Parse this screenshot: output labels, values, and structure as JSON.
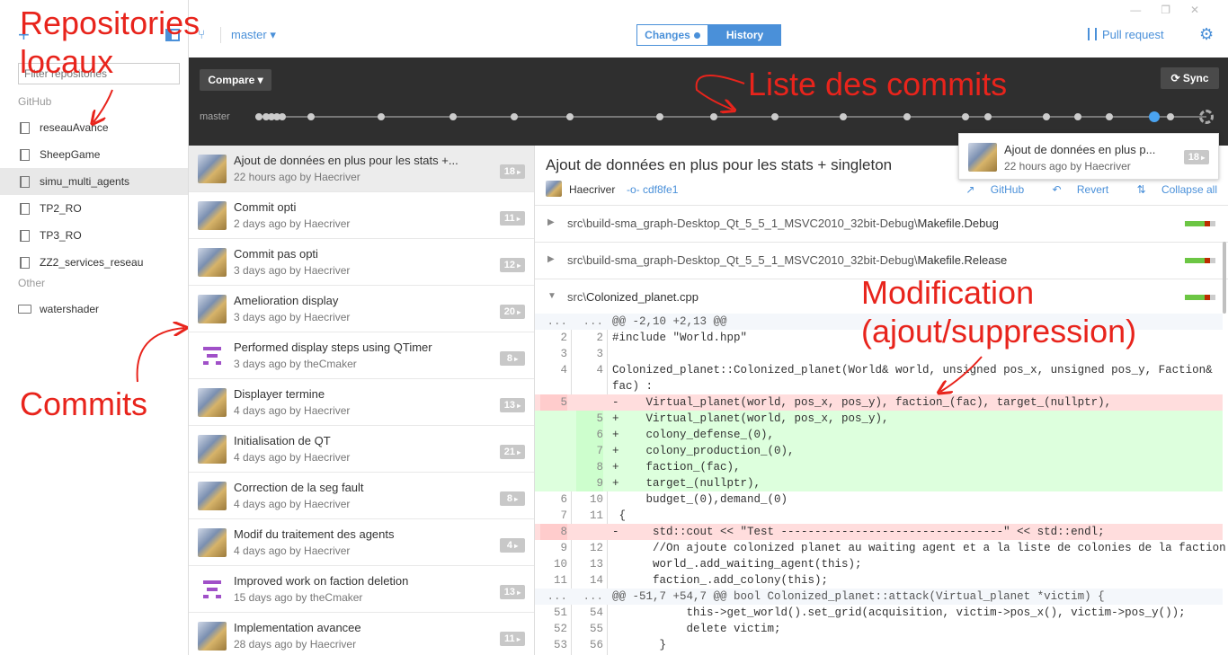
{
  "sidebar": {
    "filter_placeholder": "Filter repositories",
    "sections": [
      {
        "label": "GitHub",
        "items": [
          "reseauAvance",
          "SheepGame",
          "simu_multi_agents",
          "TP2_RO",
          "TP3_RO",
          "ZZ2_services_reseau"
        ]
      },
      {
        "label": "Other",
        "items": [
          "watershader"
        ]
      }
    ],
    "selected": "simu_multi_agents"
  },
  "topbar": {
    "branch": "master ▾",
    "tab_changes": "Changes",
    "tab_history": "History",
    "pull_request": "Pull request"
  },
  "timeline": {
    "compare": "Compare ▾",
    "sync": "Sync",
    "branch_label": "master"
  },
  "tooltip": {
    "title": "Ajout de données en plus p...",
    "meta": "22 hours ago by Haecriver",
    "badge": "18"
  },
  "commits": [
    {
      "title": "Ajout de données en plus pour les stats +...",
      "meta": "22 hours ago by Haecriver",
      "badge": "18",
      "author": "haec"
    },
    {
      "title": "Commit opti",
      "meta": "2 days ago by Haecriver",
      "badge": "11",
      "author": "haec"
    },
    {
      "title": "Commit pas opti",
      "meta": "3 days ago by Haecriver",
      "badge": "12",
      "author": "haec"
    },
    {
      "title": "Amelioration display",
      "meta": "3 days ago by Haecriver",
      "badge": "20",
      "author": "haec"
    },
    {
      "title": "Performed display steps using QTimer",
      "meta": "3 days ago by theCmaker",
      "badge": "8",
      "author": "cmaker"
    },
    {
      "title": "Displayer termine",
      "meta": "4 days ago by Haecriver",
      "badge": "13",
      "author": "haec"
    },
    {
      "title": "Initialisation de QT",
      "meta": "4 days ago by Haecriver",
      "badge": "21",
      "author": "haec"
    },
    {
      "title": "Correction de la seg fault",
      "meta": "4 days ago by Haecriver",
      "badge": "8",
      "author": "haec"
    },
    {
      "title": "Modif du traitement des agents",
      "meta": "4 days ago by Haecriver",
      "badge": "4",
      "author": "haec"
    },
    {
      "title": "Improved work on faction deletion",
      "meta": "15 days ago by theCmaker",
      "badge": "13",
      "author": "cmaker"
    },
    {
      "title": "Implementation avancee",
      "meta": "28 days ago by Haecriver",
      "badge": "11",
      "author": "haec"
    }
  ],
  "detail": {
    "title": "Ajout de données en plus pour les stats + singleton",
    "author": "Haecriver",
    "sha": "cdf8fe1",
    "actions": [
      "GitHub",
      "Revert",
      "Collapse all"
    ],
    "files": [
      {
        "dir": "src\\build-sma_graph-Desktop_Qt_5_5_1_MSVC2010_32bit-Debug\\",
        "name": "Makefile.Debug",
        "expanded": false
      },
      {
        "dir": "src\\build-sma_graph-Desktop_Qt_5_5_1_MSVC2010_32bit-Debug\\",
        "name": "Makefile.Release",
        "expanded": false
      },
      {
        "dir": "src\\",
        "name": "Colonized_planet.cpp",
        "expanded": true
      }
    ]
  },
  "diff": [
    {
      "type": "hunk",
      "old": "...",
      "new": "...",
      "code": "@@ -2,10 +2,13 @@"
    },
    {
      "type": "ctx",
      "old": "2",
      "new": "2",
      "code": "#include \"World.hpp\""
    },
    {
      "type": "ctx",
      "old": "3",
      "new": "3",
      "code": ""
    },
    {
      "type": "ctx",
      "old": "4",
      "new": "4",
      "code": "Colonized_planet::Colonized_planet(World& world, unsigned pos_x, unsigned pos_y, Faction&"
    },
    {
      "type": "ctx",
      "old": "",
      "new": "",
      "code": "fac) :"
    },
    {
      "type": "del",
      "old": "5",
      "new": "",
      "code": "-    Virtual_planet(world, pos_x, pos_y), faction_(fac), target_(nullptr),"
    },
    {
      "type": "add",
      "old": "",
      "new": "5",
      "code": "+    Virtual_planet(world, pos_x, pos_y),"
    },
    {
      "type": "add",
      "old": "",
      "new": "6",
      "code": "+    colony_defense_(0),"
    },
    {
      "type": "add",
      "old": "",
      "new": "7",
      "code": "+    colony_production_(0),"
    },
    {
      "type": "add",
      "old": "",
      "new": "8",
      "code": "+    faction_(fac),"
    },
    {
      "type": "add",
      "old": "",
      "new": "9",
      "code": "+    target_(nullptr),"
    },
    {
      "type": "ctx",
      "old": "6",
      "new": "10",
      "code": "     budget_(0),demand_(0)"
    },
    {
      "type": "ctx",
      "old": "7",
      "new": "11",
      "code": " {"
    },
    {
      "type": "del",
      "old": "8",
      "new": "",
      "code": "-     std::cout << \"Test ---------------------------------\" << std::endl;"
    },
    {
      "type": "ctx",
      "old": "9",
      "new": "12",
      "code": "      //On ajoute colonized planet au waiting agent et a la liste de colonies de la faction"
    },
    {
      "type": "ctx",
      "old": "10",
      "new": "13",
      "code": "      world_.add_waiting_agent(this);"
    },
    {
      "type": "ctx",
      "old": "11",
      "new": "14",
      "code": "      faction_.add_colony(this);"
    },
    {
      "type": "hunk",
      "old": "...",
      "new": "...",
      "code": "@@ -51,7 +54,7 @@ bool Colonized_planet::attack(Virtual_planet *victim) {"
    },
    {
      "type": "ctx",
      "old": "51",
      "new": "54",
      "code": "           this->get_world().set_grid(acquisition, victim->pos_x(), victim->pos_y());"
    },
    {
      "type": "ctx",
      "old": "52",
      "new": "55",
      "code": "           delete victim;"
    },
    {
      "type": "ctx",
      "old": "53",
      "new": "56",
      "code": "       }"
    }
  ],
  "annotations": {
    "repos_line1": "Repositories",
    "repos_line2": "locaux",
    "commits_list": "Liste des commits",
    "commits": "Commits",
    "modif_line1": "Modification",
    "modif_line2": "(ajout/suppression)"
  }
}
